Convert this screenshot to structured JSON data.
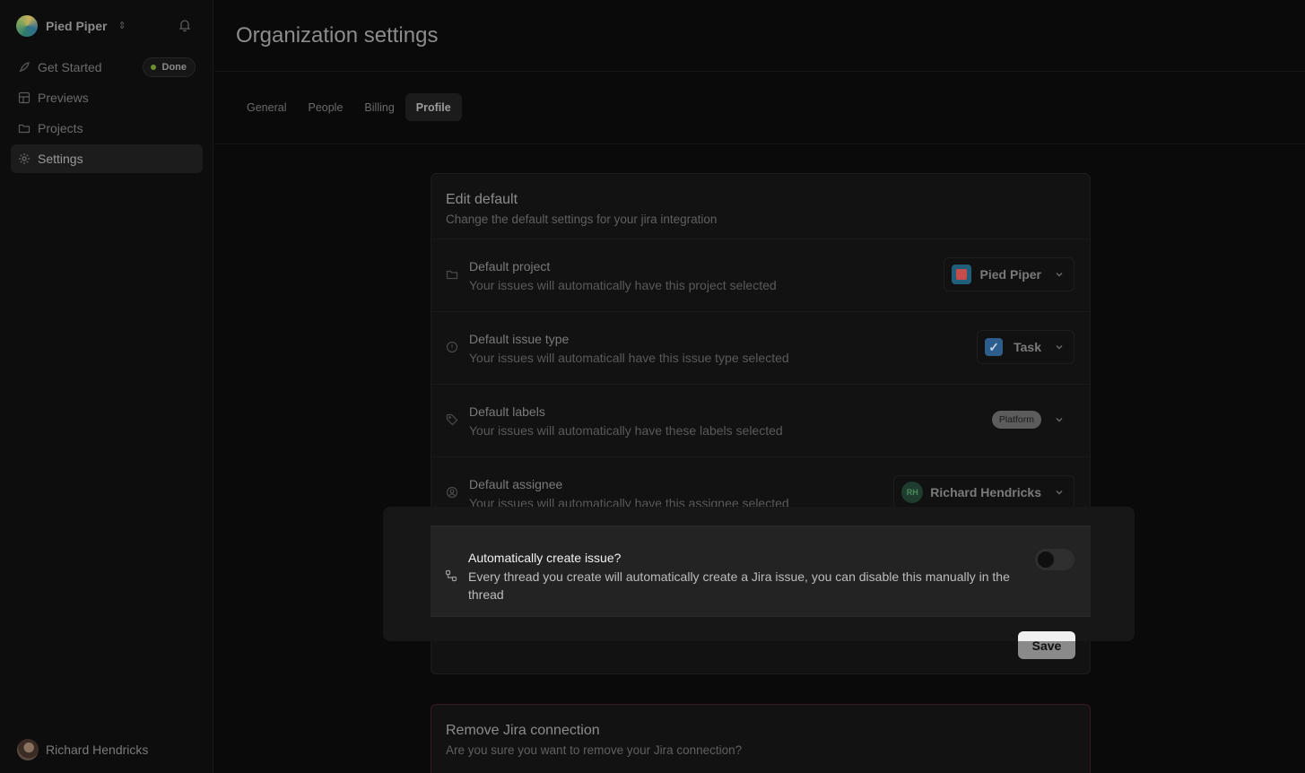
{
  "sidebar": {
    "org_name": "Pied Piper",
    "items": [
      {
        "label": "Get Started",
        "icon": "rocket-icon",
        "badge": "Done"
      },
      {
        "label": "Previews",
        "icon": "grid-icon"
      },
      {
        "label": "Projects",
        "icon": "folder-icon"
      },
      {
        "label": "Settings",
        "icon": "gear-icon"
      }
    ],
    "user_name": "Richard Hendricks"
  },
  "page": {
    "title": "Organization settings",
    "tabs": [
      "General",
      "People",
      "Billing",
      "Profile"
    ],
    "active_tab": "Profile"
  },
  "edit_default": {
    "title": "Edit default",
    "subtitle": "Change the default settings for your jira integration",
    "rows": [
      {
        "title": "Default project",
        "desc": "Your issues will automatically have this project selected",
        "value": "Pied Piper",
        "icon": "folder-icon"
      },
      {
        "title": "Default issue type",
        "desc": "Your issues will automaticall have this issue type selected",
        "value": "Task",
        "icon": "info-circle-icon"
      },
      {
        "title": "Default labels",
        "desc": "Your issues will automatically have these labels selected",
        "value": "Platform",
        "icon": "tag-icon"
      },
      {
        "title": "Default assignee",
        "desc": "Your issues will automatically have this assignee selected",
        "value": "Richard Hendricks",
        "avatar_initials": "RH",
        "icon": "user-circle-icon"
      }
    ],
    "auto_create": {
      "title": "Automatically create issue?",
      "desc": "Every thread you create will automatically create a Jira issue, you can disable this manually in the thread",
      "enabled": false
    },
    "save_label": "Save"
  },
  "remove_jira": {
    "title": "Remove Jira connection",
    "subtitle": "Are you sure you want to remove your Jira connection?"
  }
}
